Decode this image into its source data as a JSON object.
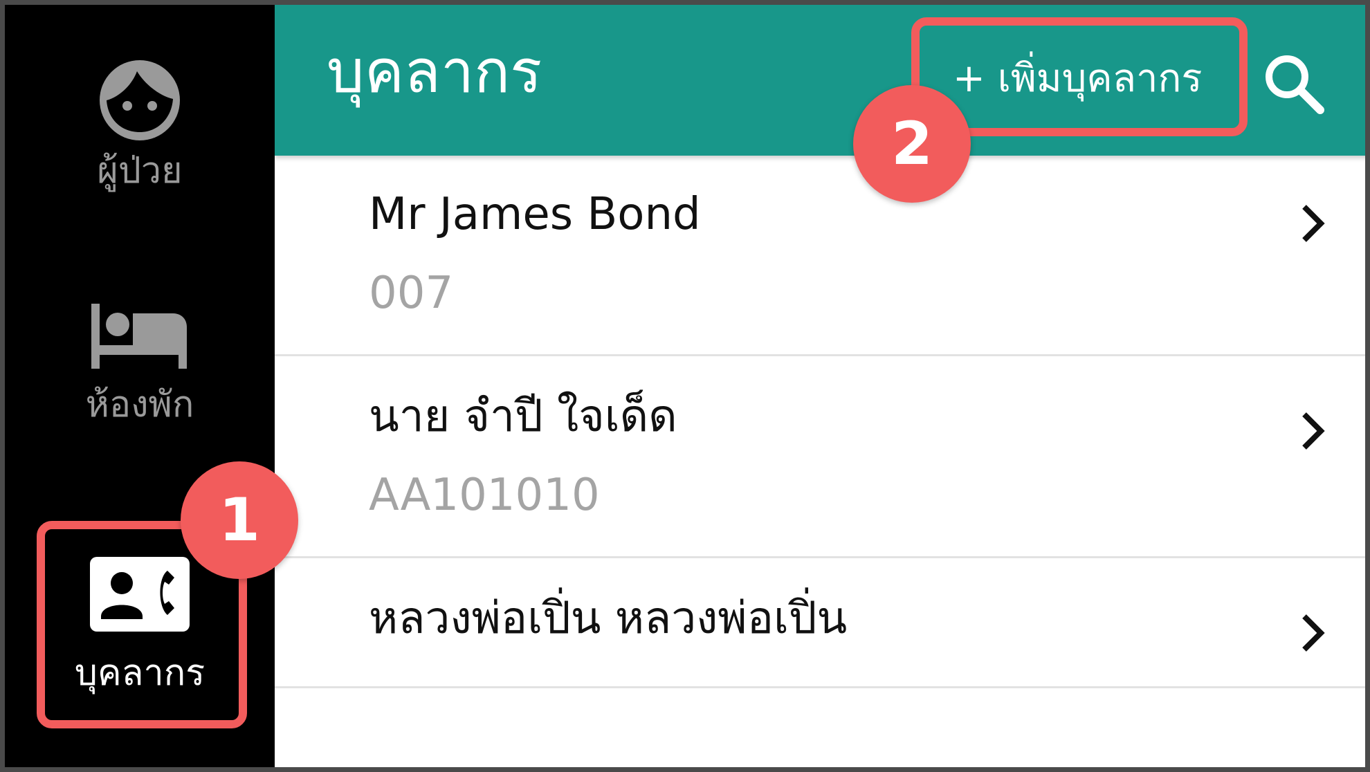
{
  "sidebar": {
    "items": [
      {
        "label": "ผู้ป่วย",
        "icon": "face-icon",
        "active": false
      },
      {
        "label": "ห้องพัก",
        "icon": "bed-icon",
        "active": false
      },
      {
        "label": "บุคลากร",
        "icon": "contact-phone-icon",
        "active": true
      }
    ]
  },
  "header": {
    "title": "บุคลากร",
    "add_label": "+ เพิ่มบุคลากร",
    "search_icon": "search-icon"
  },
  "list": {
    "rows": [
      {
        "name": "Mr James Bond",
        "code": "007"
      },
      {
        "name": "นาย จำปี ใจเด็ด",
        "code": "AA101010"
      },
      {
        "name": "หลวงพ่อเปิ่น หลวงพ่อเปิ่น",
        "code": ""
      }
    ]
  },
  "callouts": [
    {
      "number": "1"
    },
    {
      "number": "2"
    }
  ],
  "colors": {
    "header": "#18978a",
    "sidebar": "#000000",
    "callout": "#f25c5c",
    "inactive_nav": "#9a9a9a",
    "secondary_text": "#a4a4a4"
  }
}
